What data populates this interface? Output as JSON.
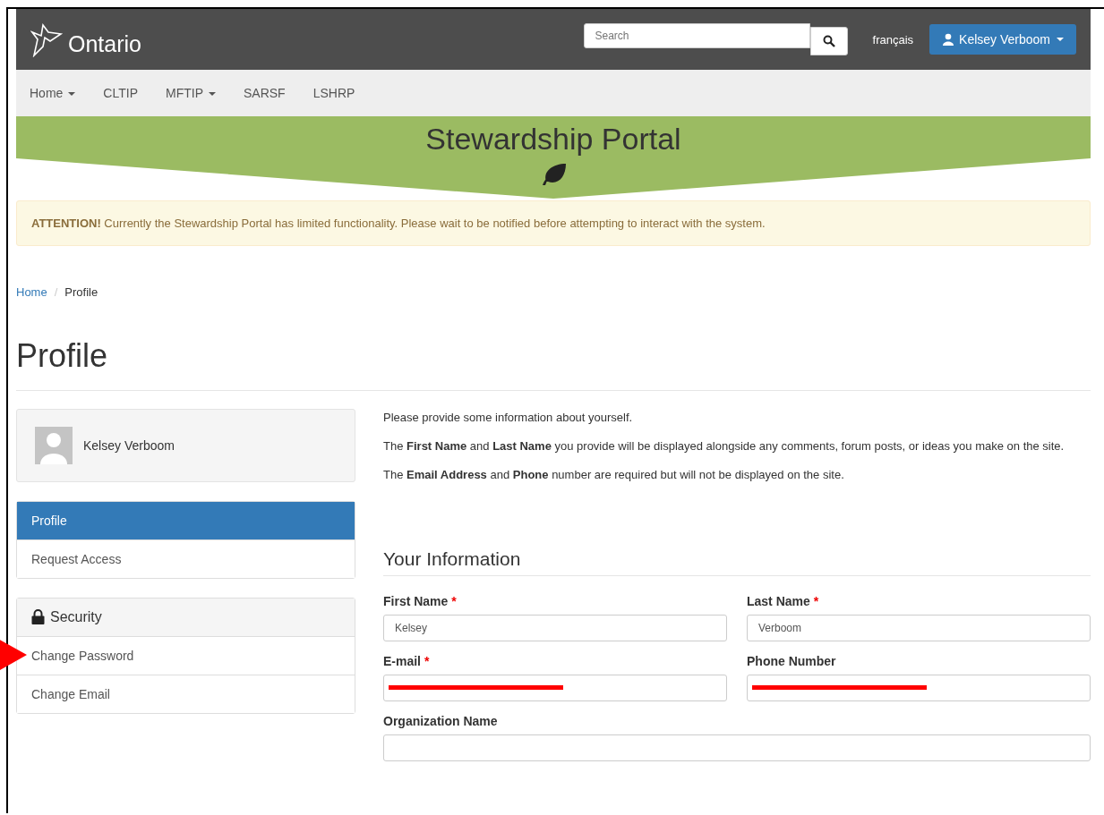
{
  "header": {
    "logo_text": "Ontario",
    "search": {
      "placeholder": "Search"
    },
    "language_link": "français",
    "user_button": "Kelsey Verboom"
  },
  "nav": [
    {
      "label": "Home",
      "dropdown": true
    },
    {
      "label": "CLTIP",
      "dropdown": false
    },
    {
      "label": "MFTIP",
      "dropdown": true
    },
    {
      "label": "SARSF",
      "dropdown": false
    },
    {
      "label": "LSHRP",
      "dropdown": false
    }
  ],
  "banner": {
    "title": "Stewardship Portal"
  },
  "alert": {
    "lead": "ATTENTION!",
    "message": "Currently the Stewardship Portal has limited functionality. Please wait to be notified before attempting to interact with the system."
  },
  "breadcrumb": {
    "separator": "/",
    "items": [
      {
        "label": "Home",
        "current": false
      },
      {
        "label": "Profile",
        "current": true
      }
    ]
  },
  "page_title": "Profile",
  "sidebar": {
    "user_name": "Kelsey Verboom",
    "menu": [
      {
        "label": "Profile",
        "selected": true
      },
      {
        "label": "Request Access",
        "selected": false
      }
    ],
    "security": {
      "title": "Security",
      "items": [
        {
          "label": "Change Password",
          "pointed": true
        },
        {
          "label": "Change Email",
          "pointed": false
        }
      ]
    }
  },
  "intro": [
    "Please provide some information about yourself.",
    "The **First Name** and **Last Name** you provide will be displayed alongside any comments, forum posts, or ideas you make on the site.",
    "The **Email Address** and **Phone** number are required but will not be displayed on the site."
  ],
  "form": {
    "title": "Your Information",
    "required_mark": "*",
    "fields": [
      {
        "label": "First Name",
        "required": true,
        "value": "Kelsey",
        "redacted": false,
        "wide": false
      },
      {
        "label": "Last Name",
        "required": true,
        "value": "Verboom",
        "redacted": false,
        "wide": false
      },
      {
        "label": "E-mail",
        "required": true,
        "redacted": true,
        "wide": false
      },
      {
        "label": "Phone Number",
        "required": false,
        "redacted": true,
        "wide": false
      },
      {
        "label": "Organization Name",
        "required": false,
        "redacted": false,
        "wide": true
      }
    ]
  }
}
